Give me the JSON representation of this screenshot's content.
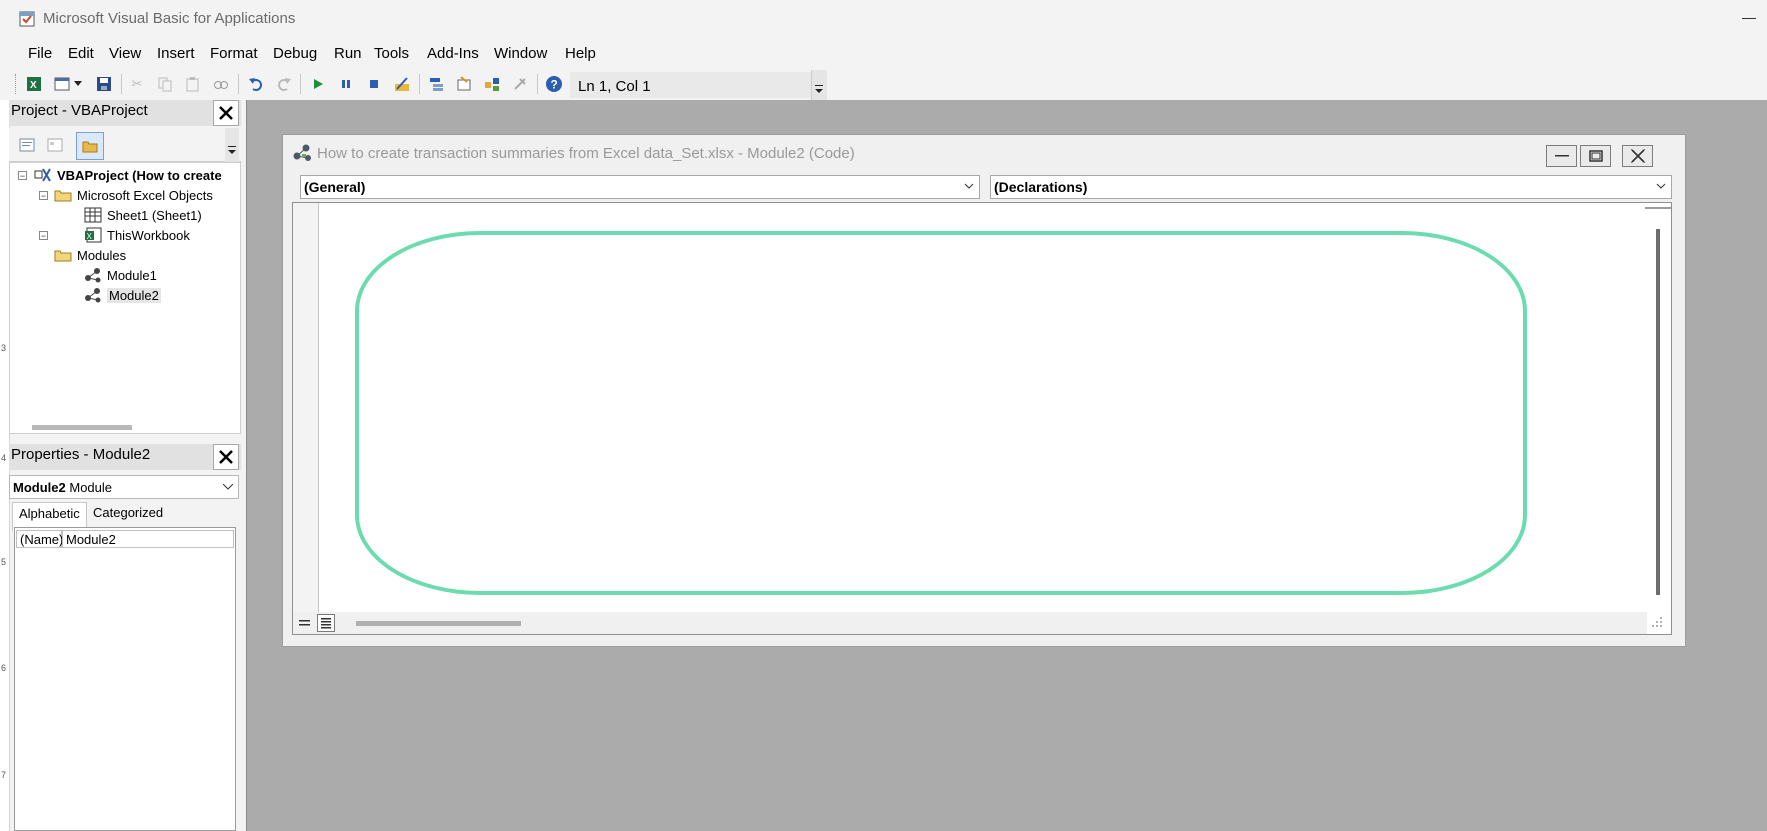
{
  "app": {
    "title": "Microsoft Visual Basic for Applications"
  },
  "menu": [
    "File",
    "Edit",
    "View",
    "Insert",
    "Format",
    "Debug",
    "Run",
    "Tools",
    "Add-Ins",
    "Window",
    "Help"
  ],
  "toolbar": {
    "status": "Ln 1, Col 1"
  },
  "project_panel": {
    "title": "Project - VBAProject",
    "tree": {
      "root": "VBAProject (How to create",
      "excel_objects_folder": "Microsoft Excel Objects",
      "sheet1": "Sheet1 (Sheet1)",
      "thisworkbook": "ThisWorkbook",
      "modules_folder": "Modules",
      "module1": "Module1",
      "module2": "Module2"
    }
  },
  "properties_panel": {
    "title": "Properties - Module2",
    "object_name": "Module2",
    "object_type": "Module",
    "tabs": [
      "Alphabetic",
      "Categorized"
    ],
    "row": {
      "key": "(Name)",
      "value": "Module2"
    }
  },
  "code_window": {
    "title": "How to create transaction summaries from Excel data_Set.xlsx - Module2 (Code)",
    "object_combo": "(General)",
    "procedure_combo": "(Declarations)"
  },
  "colors": {
    "highlight": "#6cdcb0",
    "workspace": "#ababab"
  }
}
